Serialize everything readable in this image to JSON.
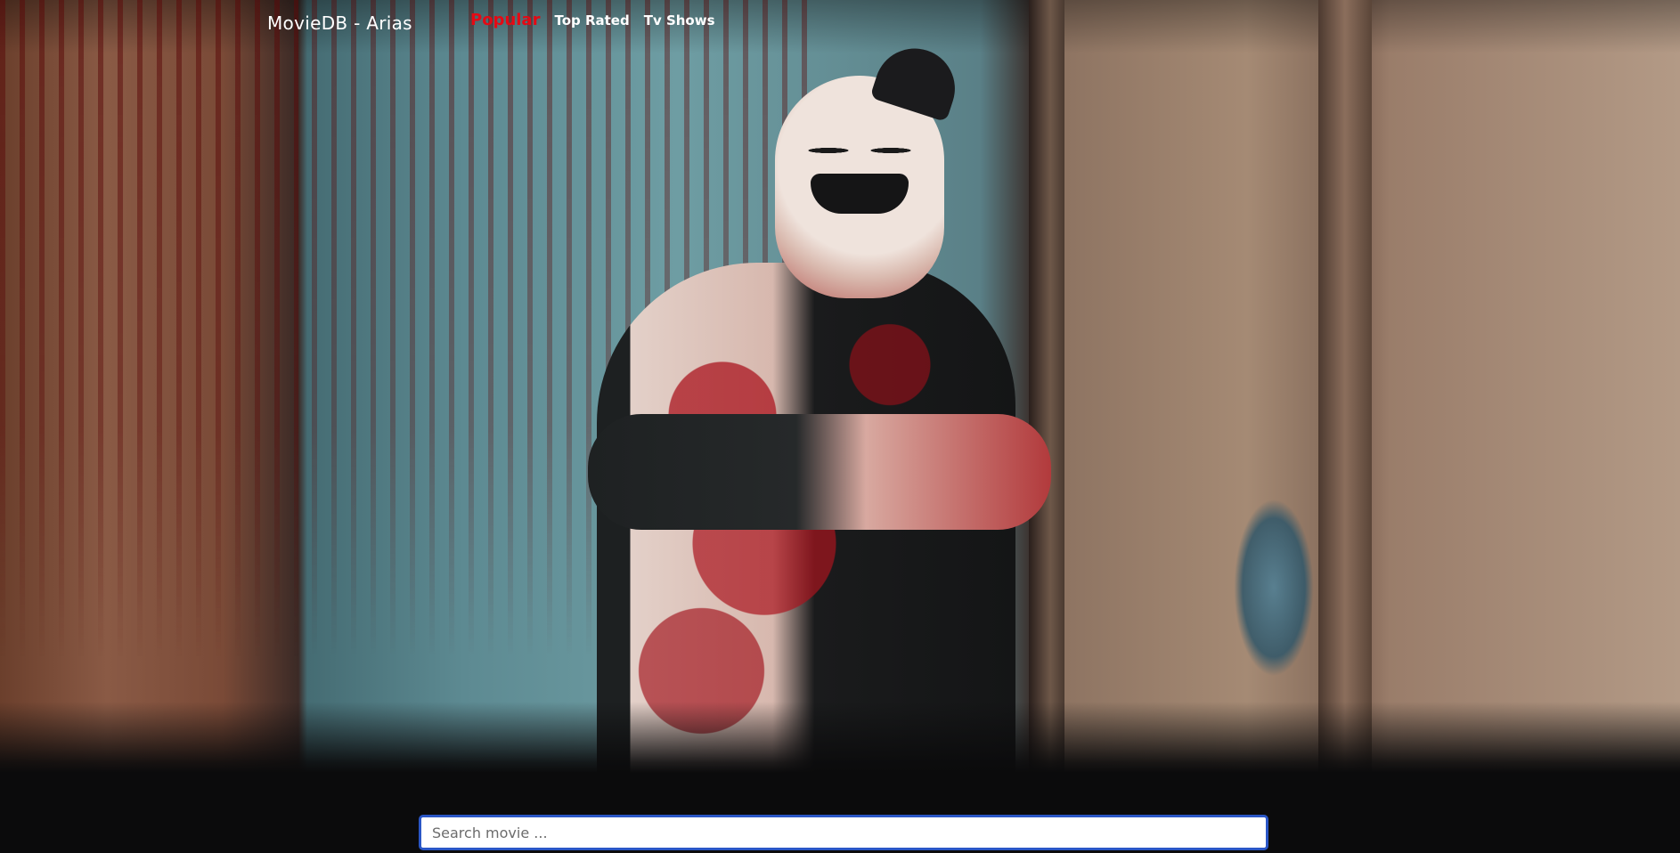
{
  "navbar": {
    "brand": "MovieDB - Arias",
    "links": [
      {
        "label": "Popular",
        "active": true
      },
      {
        "label": "Top Rated",
        "active": false
      },
      {
        "label": "Tv Shows",
        "active": false
      }
    ]
  },
  "search": {
    "placeholder": "Search movie ...",
    "value": ""
  },
  "colors": {
    "background": "#0b0b0c",
    "active_link": "#e50914",
    "link": "#ffffff",
    "search_border": "#2a56c6"
  }
}
